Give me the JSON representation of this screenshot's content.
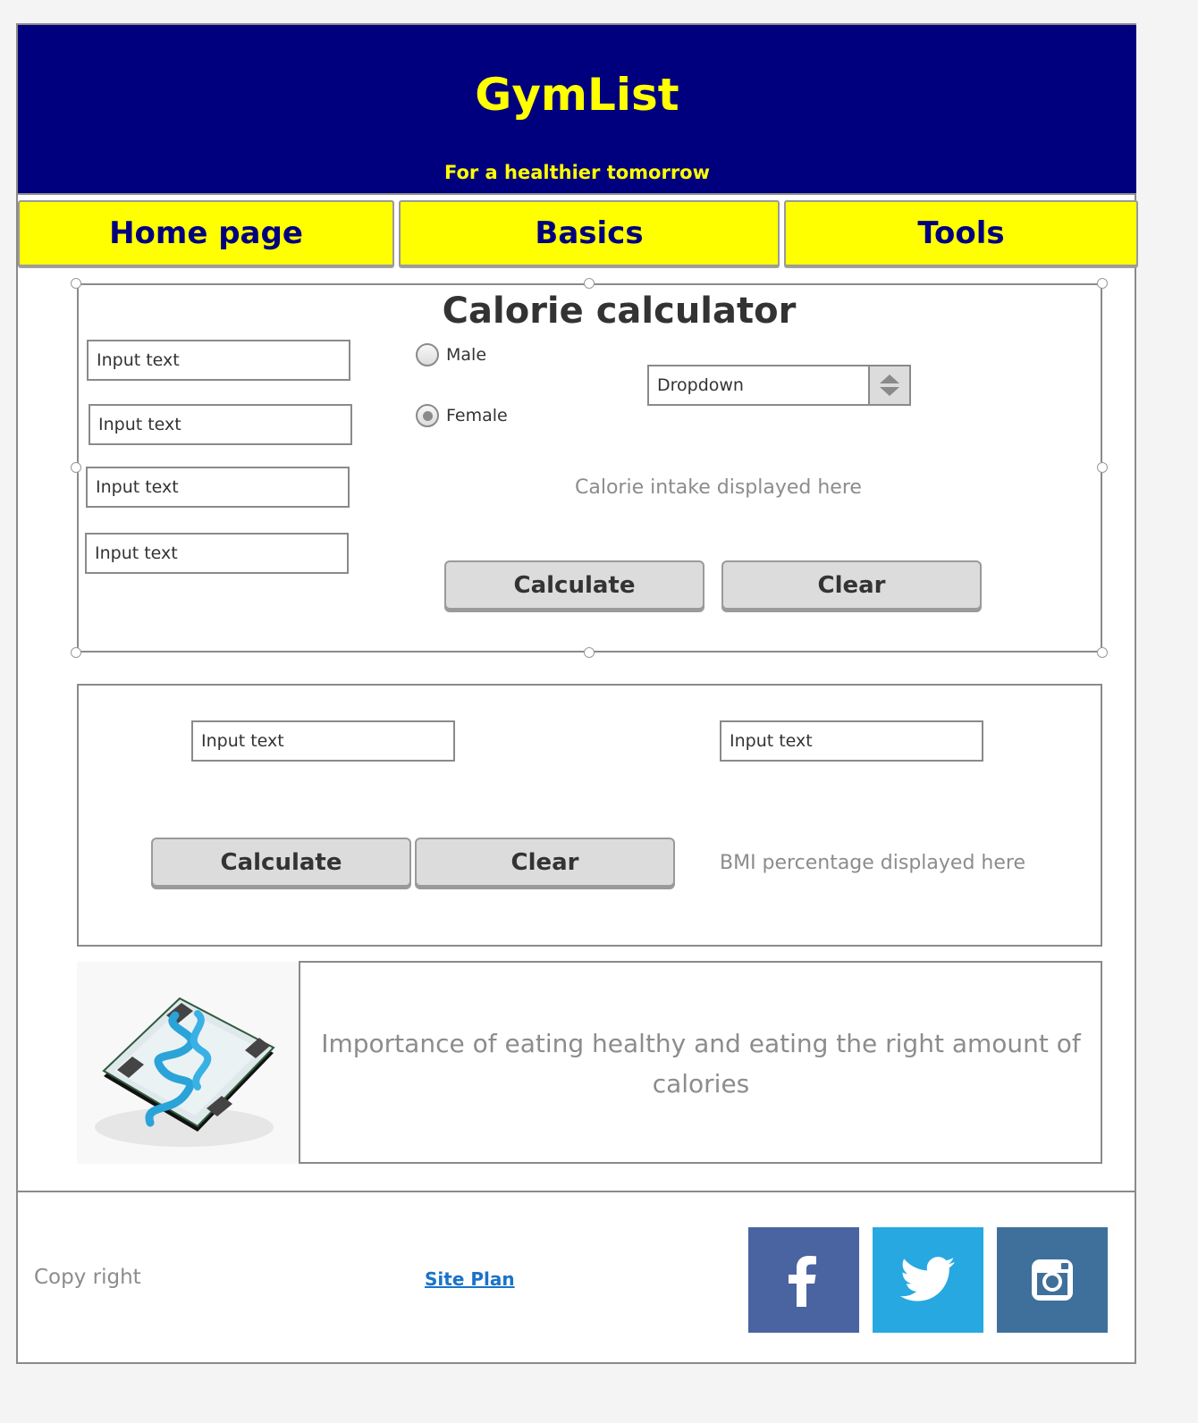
{
  "header": {
    "title": "GymList",
    "subtitle": "For a healthier tomorrow",
    "background": "#00007f",
    "text_color": "#ffff00"
  },
  "nav": {
    "tabs": [
      {
        "label": "Home page"
      },
      {
        "label": "Basics"
      },
      {
        "label": "Tools"
      }
    ],
    "background": "#ffff00",
    "text_color": "#00007f"
  },
  "calorie": {
    "title": "Calorie calculator",
    "inputs": [
      {
        "placeholder": "Input text"
      },
      {
        "placeholder": "Input text"
      },
      {
        "placeholder": "Input text"
      },
      {
        "placeholder": "Input text"
      }
    ],
    "gender": {
      "options": [
        {
          "label": "Male",
          "selected": false
        },
        {
          "label": "Female",
          "selected": true
        }
      ]
    },
    "dropdown": {
      "value": "Dropdown"
    },
    "result": "Calorie intake displayed here",
    "calculate_label": "Calculate",
    "clear_label": "Clear"
  },
  "bmi": {
    "inputs": [
      {
        "placeholder": "Input text"
      },
      {
        "placeholder": "Input text"
      }
    ],
    "calculate_label": "Calculate",
    "clear_label": "Clear",
    "result": "BMI percentage displayed here"
  },
  "info": {
    "image_icon": "scale-with-measuring-tape",
    "text": "Importance of eating healthy and eating the right amount of calories"
  },
  "footer": {
    "copyright": "Copy right",
    "site_plan": "Site Plan",
    "social": [
      {
        "icon": "facebook-icon",
        "color": "#4a64a1"
      },
      {
        "icon": "twitter-icon",
        "color": "#27a8e0"
      },
      {
        "icon": "instagram-icon",
        "color": "#3f709b"
      }
    ]
  }
}
